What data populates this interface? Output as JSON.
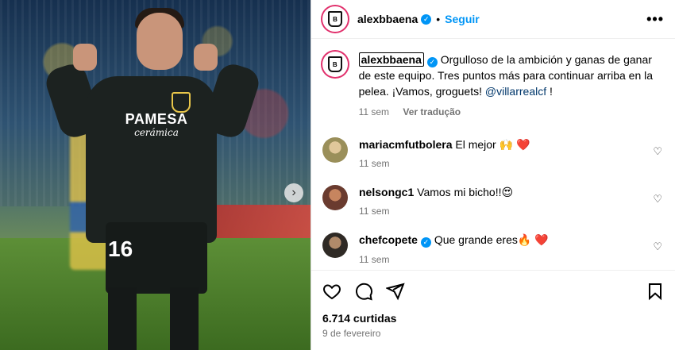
{
  "header": {
    "username": "alexbbaena",
    "follow_label": "Seguir",
    "more_label": "•••"
  },
  "caption": {
    "username": "alexbbaena",
    "text": "Orgulloso de la ambición y ganas de ganar de este equipo. Tres puntos más para continuar arriba en la pelea. ¡Vamos, groguets!",
    "mention": "@villarrealcf",
    "suffix": " !",
    "time": "11 sem",
    "translate_label": "Ver tradução"
  },
  "comments": [
    {
      "user": "mariacmfutbolera",
      "text": "El mejor 🙌 ",
      "emoji_heart": "❤️",
      "time": "11 sem",
      "verified": false,
      "avatar_color": "#9a8f5a"
    },
    {
      "user": "nelsongc1",
      "text": "Vamos mi bicho!!",
      "emoji_heart": "😍",
      "time": "11 sem",
      "verified": false,
      "avatar_color": "#6a3b2f"
    },
    {
      "user": "chefcopete",
      "text": "Que grande eres🔥 ",
      "emoji_heart": "❤️",
      "time": "11 sem",
      "verified": true,
      "avatar_color": "#2f2a25"
    }
  ],
  "photo": {
    "sponsor": "PAMESA",
    "sponsor_sub": "cerámica",
    "shirt_number": "16",
    "carousel_next_label": "›"
  },
  "post": {
    "likes": "6.714 curtidas",
    "date": "9 de fevereiro"
  },
  "colors": {
    "accent": "#0095f6",
    "verified": "#0095f6",
    "heart": "#ed4956"
  }
}
